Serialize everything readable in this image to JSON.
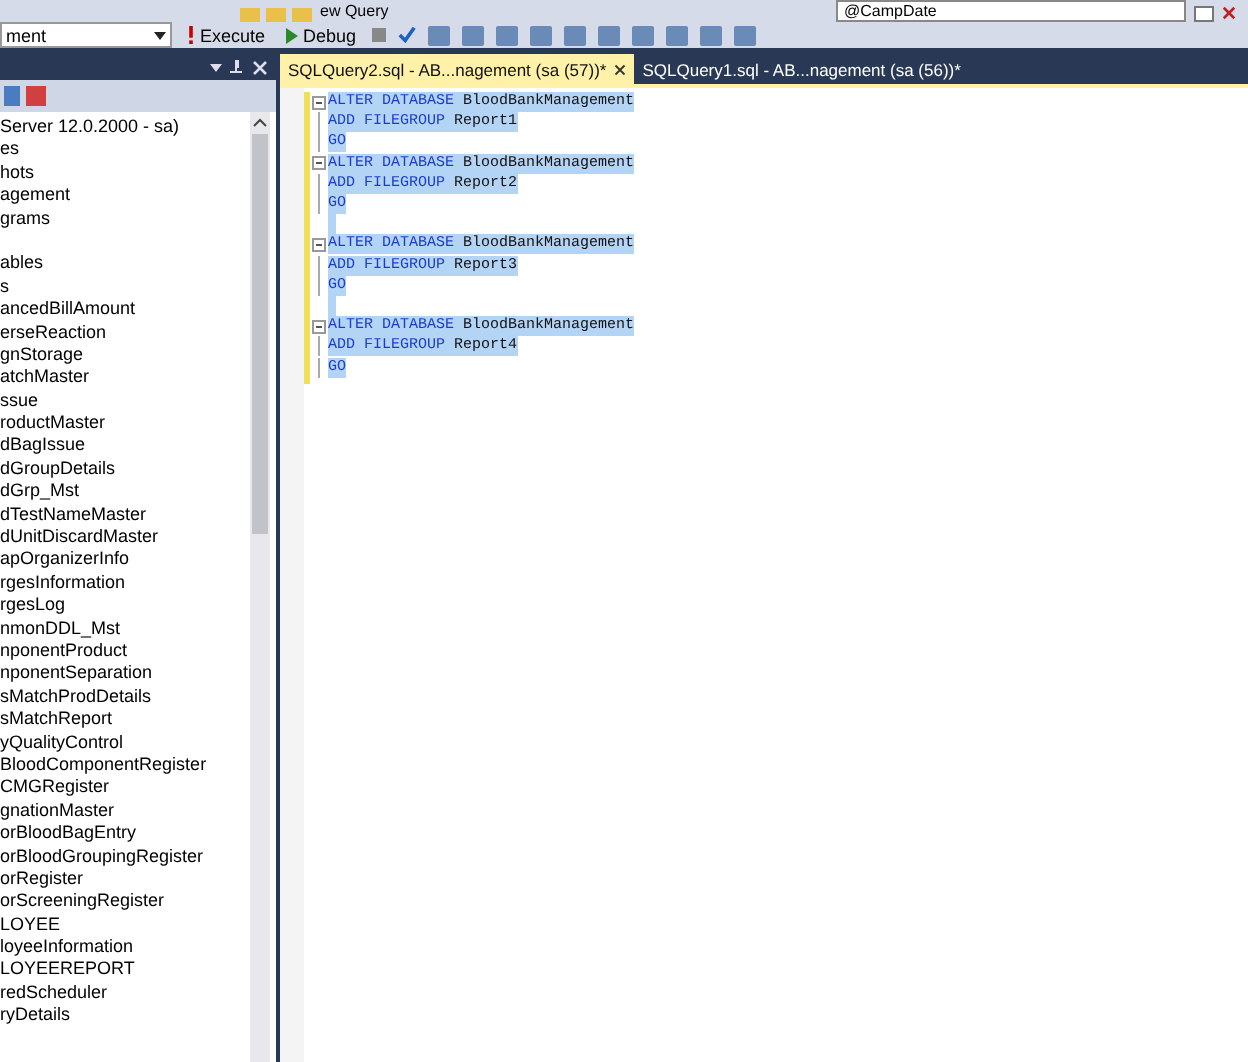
{
  "toolbar": {
    "new_query": "ew Query",
    "database": "ment",
    "execute": "Execute",
    "debug": "Debug",
    "parameter": "@CampDate"
  },
  "object_explorer": {
    "server": "Server 12.0.2000 - sa)",
    "items": [
      {
        "kind": "item",
        "label": "es"
      },
      {
        "kind": "item",
        "label": "hots"
      },
      {
        "kind": "item",
        "label": "agement"
      },
      {
        "kind": "item",
        "label": "grams"
      },
      {
        "kind": "blank"
      },
      {
        "kind": "item",
        "label": "ables"
      },
      {
        "kind": "item",
        "label": "s"
      },
      {
        "kind": "item",
        "label": "ancedBillAmount"
      },
      {
        "kind": "item",
        "label": "erseReaction"
      },
      {
        "kind": "item",
        "label": "gnStorage"
      },
      {
        "kind": "item",
        "label": "atchMaster"
      },
      {
        "kind": "item",
        "label": "ssue"
      },
      {
        "kind": "item",
        "label": "roductMaster"
      },
      {
        "kind": "item",
        "label": "dBagIssue"
      },
      {
        "kind": "item",
        "label": "dGroupDetails"
      },
      {
        "kind": "item",
        "label": "dGrp_Mst"
      },
      {
        "kind": "item",
        "label": "dTestNameMaster"
      },
      {
        "kind": "item",
        "label": "dUnitDiscardMaster"
      },
      {
        "kind": "item",
        "label": "apOrganizerInfo"
      },
      {
        "kind": "item",
        "label": "rgesInformation"
      },
      {
        "kind": "item",
        "label": "rgesLog"
      },
      {
        "kind": "item",
        "label": "nmonDDL_Mst"
      },
      {
        "kind": "item",
        "label": "nponentProduct"
      },
      {
        "kind": "item",
        "label": "nponentSeparation"
      },
      {
        "kind": "item",
        "label": "sMatchProdDetails"
      },
      {
        "kind": "item",
        "label": "sMatchReport"
      },
      {
        "kind": "item",
        "label": "yQualityControl"
      },
      {
        "kind": "item",
        "label": "BloodComponentRegister"
      },
      {
        "kind": "item",
        "label": "CMGRegister"
      },
      {
        "kind": "item",
        "label": "gnationMaster"
      },
      {
        "kind": "item",
        "label": "orBloodBagEntry"
      },
      {
        "kind": "item",
        "label": "orBloodGroupingRegister"
      },
      {
        "kind": "item",
        "label": "orRegister"
      },
      {
        "kind": "item",
        "label": "orScreeningRegister"
      },
      {
        "kind": "item",
        "label": "LOYEE"
      },
      {
        "kind": "item",
        "label": "loyeeInformation"
      },
      {
        "kind": "item",
        "label": "LOYEEREPORT"
      },
      {
        "kind": "item",
        "label": "redScheduler"
      },
      {
        "kind": "item",
        "label": "ryDetails"
      }
    ]
  },
  "tabs": [
    {
      "label": "SQLQuery2.sql - AB...nagement (sa (57))*",
      "selected": true
    },
    {
      "label": "SQLQuery1.sql - AB...nagement (sa (56))*",
      "selected": false
    }
  ],
  "code": [
    {
      "kind": "code",
      "fold": true,
      "keyword": "ALTER DATABASE",
      "name": "BloodBankManagement"
    },
    {
      "kind": "code",
      "fold": false,
      "keyword": "ADD FILEGROUP",
      "name": "Report1"
    },
    {
      "kind": "code",
      "fold": false,
      "keyword": "GO"
    },
    {
      "kind": "code",
      "fold": true,
      "keyword": "ALTER DATABASE",
      "name": "BloodBankManagement"
    },
    {
      "kind": "code",
      "fold": false,
      "keyword": "ADD FILEGROUP",
      "name": "Report2"
    },
    {
      "kind": "code",
      "fold": false,
      "keyword": "GO"
    },
    {
      "kind": "blank"
    },
    {
      "kind": "code",
      "fold": true,
      "keyword": "ALTER DATABASE",
      "name": "BloodBankManagement"
    },
    {
      "kind": "code",
      "fold": false,
      "keyword": "ADD FILEGROUP",
      "name": "Report3"
    },
    {
      "kind": "code",
      "fold": false,
      "keyword": "GO"
    },
    {
      "kind": "blank"
    },
    {
      "kind": "code",
      "fold": true,
      "keyword": "ALTER DATABASE",
      "name": "BloodBankManagement"
    },
    {
      "kind": "code",
      "fold": false,
      "keyword": "ADD FILEGROUP",
      "name": "Report4"
    },
    {
      "kind": "code",
      "fold": false,
      "keyword": "GO"
    }
  ]
}
